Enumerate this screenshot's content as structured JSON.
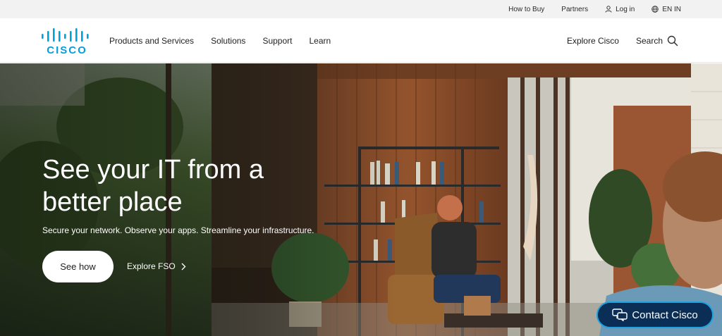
{
  "utility": {
    "how_to_buy": "How to Buy",
    "partners": "Partners",
    "login": "Log in",
    "language": "EN IN"
  },
  "logo": {
    "text": "CISCO",
    "color": "#049fd9"
  },
  "nav": {
    "items": [
      "Products and Services",
      "Solutions",
      "Support",
      "Learn"
    ],
    "explore": "Explore Cisco",
    "search": "Search"
  },
  "hero": {
    "title": "See your IT from a better place",
    "subtitle": "Secure your network. Observe your apps. Streamline your infrastructure.",
    "primary_cta": "See how",
    "secondary_cta": "Explore FSO"
  },
  "contact": {
    "label": "Contact Cisco"
  },
  "colors": {
    "accent": "#049fd9",
    "contact_bg": "#0a2e56",
    "contact_border": "#1ca2e0"
  },
  "icons": [
    "user-icon",
    "globe-icon",
    "search-icon",
    "chevron-right-icon",
    "chat-icon"
  ]
}
